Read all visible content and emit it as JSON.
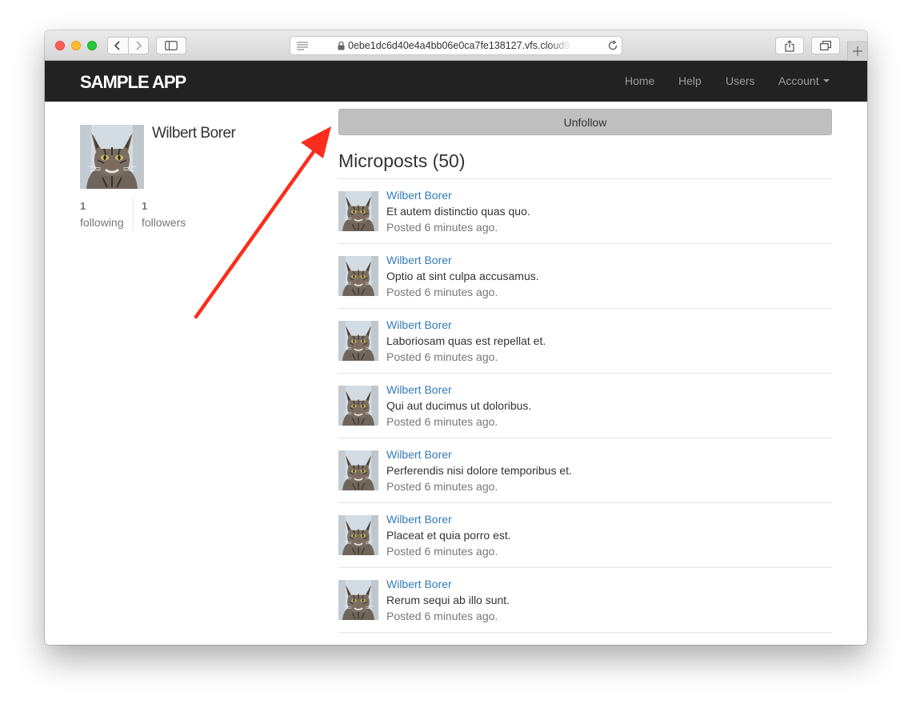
{
  "browser": {
    "url": "0ebe1dc6d40e4a4bb06e0ca7fe138127.vfs.cloud9",
    "window_buttons": [
      "close",
      "minimize",
      "zoom"
    ],
    "icons": [
      "back-icon",
      "forward-icon",
      "sidebar-icon",
      "page-menu-icon",
      "lock-icon",
      "reload-icon",
      "share-icon",
      "tabs-icon",
      "new-tab-icon"
    ]
  },
  "navbar": {
    "logo": "SAMPLE APP",
    "links": [
      "Home",
      "Help",
      "Users"
    ],
    "account": "Account"
  },
  "profile": {
    "name": "Wilbert Borer",
    "following_count": "1",
    "following_label": "following",
    "followers_count": "1",
    "followers_label": "followers"
  },
  "unfollow_label": "Unfollow",
  "microposts": {
    "title": "Microposts (50)",
    "items": [
      {
        "author": "Wilbert Borer",
        "content": "Et autem distinctio quas quo.",
        "time": "Posted 6 minutes ago."
      },
      {
        "author": "Wilbert Borer",
        "content": "Optio at sint culpa accusamus.",
        "time": "Posted 6 minutes ago."
      },
      {
        "author": "Wilbert Borer",
        "content": "Laboriosam quas est repellat et.",
        "time": "Posted 6 minutes ago."
      },
      {
        "author": "Wilbert Borer",
        "content": "Qui aut ducimus ut doloribus.",
        "time": "Posted 6 minutes ago."
      },
      {
        "author": "Wilbert Borer",
        "content": "Perferendis nisi dolore temporibus et.",
        "time": "Posted 6 minutes ago."
      },
      {
        "author": "Wilbert Borer",
        "content": "Placeat et quia porro est.",
        "time": "Posted 6 minutes ago."
      },
      {
        "author": "Wilbert Borer",
        "content": "Rerum sequi ab illo sunt.",
        "time": "Posted 6 minutes ago."
      }
    ]
  },
  "colors": {
    "navbar_bg": "#222222",
    "nav_link": "#9d9d9d",
    "link_blue": "#337ab7",
    "muted": "#777777",
    "unfollow_bg": "#bfbfbf",
    "annotation_arrow": "#fc2d1c"
  }
}
